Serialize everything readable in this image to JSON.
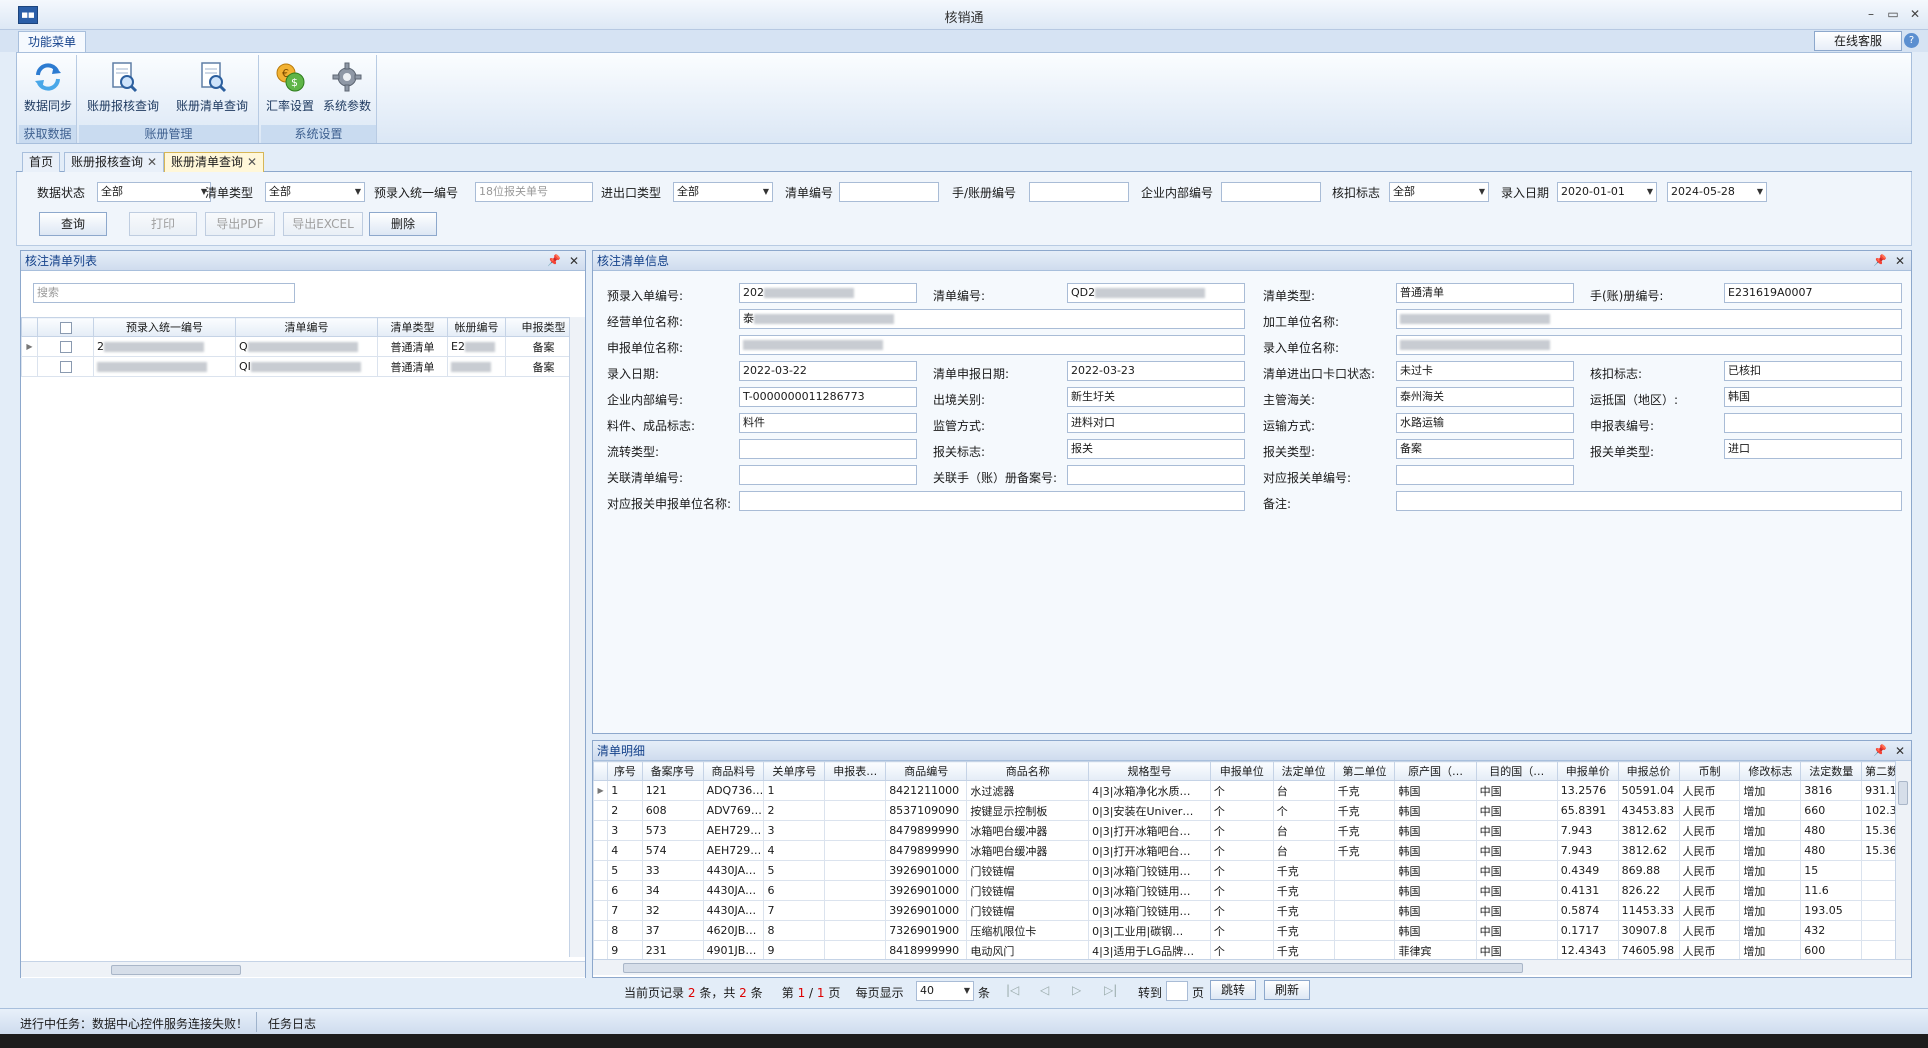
{
  "window": {
    "title": "核销通",
    "minimize": "–",
    "restore": "▭",
    "close": "✕"
  },
  "ribbon": {
    "tab": "功能菜单",
    "online_service": "在线客服",
    "help": "?",
    "groups": [
      {
        "label": "获取数据",
        "buttons": [
          {
            "label": "数据同步",
            "icon": "sync-icon"
          }
        ]
      },
      {
        "label": "账册管理",
        "buttons": [
          {
            "label": "账册报核查询",
            "icon": "document-search-icon"
          },
          {
            "label": "账册清单查询",
            "icon": "document-search-icon"
          }
        ]
      },
      {
        "label": "系统设置",
        "buttons": [
          {
            "label": "汇率设置",
            "icon": "exchange-rate-icon"
          },
          {
            "label": "系统参数",
            "icon": "gear-icon"
          }
        ]
      }
    ]
  },
  "doc_tabs": [
    {
      "label": "首页",
      "closable": false
    },
    {
      "label": "账册报核查询",
      "closable": true
    },
    {
      "label": "账册清单查询",
      "closable": true,
      "active": true
    }
  ],
  "filters": {
    "data_status": {
      "label": "数据状态",
      "value": "全部"
    },
    "list_type": {
      "label": "清单类型",
      "value": "全部"
    },
    "pre_entry_no": {
      "label": "预录入统一编号",
      "placeholder": "18位报关单号"
    },
    "ie_type": {
      "label": "进出口类型",
      "value": "全部"
    },
    "list_no": {
      "label": "清单编号",
      "value": ""
    },
    "manual_no": {
      "label": "手/账册编号",
      "value": ""
    },
    "internal_no": {
      "label": "企业内部编号",
      "value": ""
    },
    "verify_flag": {
      "label": "核扣标志",
      "value": "全部"
    },
    "entry_date": {
      "label": "录入日期",
      "from": "2020-01-01",
      "to": "2024-05-28"
    }
  },
  "actions": {
    "query": "查询",
    "print": "打印",
    "export_pdf": "导出PDF",
    "export_excel": "导出EXCEL",
    "delete": "删除"
  },
  "list_panel": {
    "title": "核注清单列表",
    "search_placeholder": "搜索",
    "columns": [
      "预录入统一编号",
      "清单编号",
      "清单类型",
      "帐册编号",
      "申报类型"
    ],
    "rows": [
      {
        "pre_no": "2",
        "list_no": "Q",
        "type": "普通清单",
        "book": "E2",
        "decl": "备案"
      },
      {
        "pre_no": "",
        "list_no": "QI",
        "type": "普通清单",
        "book": "",
        "decl": "备案"
      }
    ]
  },
  "info_panel": {
    "title": "核注清单信息",
    "fields": {
      "pre_no": {
        "label": "预录入单编号:",
        "value": "202"
      },
      "list_no": {
        "label": "清单编号:",
        "value": "QD2"
      },
      "list_type": {
        "label": "清单类型:",
        "value": "普通清单"
      },
      "book_no": {
        "label": "手(账)册编号:",
        "value": "E231619A0007"
      },
      "biz_unit": {
        "label": "经营单位名称:",
        "value": "泰"
      },
      "proc_unit": {
        "label": "加工单位名称:",
        "value": ""
      },
      "decl_unit": {
        "label": "申报单位名称:",
        "value": ""
      },
      "entry_unit": {
        "label": "录入单位名称:",
        "value": ""
      },
      "entry_date": {
        "label": "录入日期:",
        "value": "2022-03-22"
      },
      "decl_date": {
        "label": "清单申报日期:",
        "value": "2022-03-23"
      },
      "gate_status": {
        "label": "清单进出口卡口状态:",
        "value": "未过卡"
      },
      "verify_flag": {
        "label": "核扣标志:",
        "value": "已核扣"
      },
      "internal_no": {
        "label": "企业内部编号:",
        "value": "T-0000000011286773"
      },
      "port": {
        "label": "出境关别:",
        "value": "新生圩关"
      },
      "customs": {
        "label": "主管海关:",
        "value": "泰州海关"
      },
      "country": {
        "label": "运抵国（地区）:",
        "value": "韩国"
      },
      "material_flag": {
        "label": "料件、成品标志:",
        "value": "料件"
      },
      "supervision": {
        "label": "监管方式:",
        "value": "进料对口"
      },
      "transport": {
        "label": "运输方式:",
        "value": "水路运输"
      },
      "decl_form_no": {
        "label": "申报表编号:",
        "value": ""
      },
      "flow_type": {
        "label": "流转类型:",
        "value": ""
      },
      "customs_flag": {
        "label": "报关标志:",
        "value": "报关"
      },
      "customs_type": {
        "label": "报关类型:",
        "value": "备案"
      },
      "customs_form_type": {
        "label": "报关单类型:",
        "value": "进口"
      },
      "related_list": {
        "label": "关联清单编号:",
        "value": ""
      },
      "related_book": {
        "label": "关联手（账）册备案号:",
        "value": ""
      },
      "related_customs_no": {
        "label": "对应报关单编号:",
        "value": ""
      },
      "related_decl_unit": {
        "label": "对应报关申报单位名称:",
        "value": ""
      },
      "remark": {
        "label": "备注:",
        "value": ""
      }
    }
  },
  "detail_panel": {
    "title": "清单明细",
    "columns": [
      "序号",
      "备案序号",
      "商品料号",
      "关单序号",
      "申报表…",
      "商品编号",
      "商品名称",
      "规格型号",
      "申报单位",
      "法定单位",
      "第二单位",
      "原产国（…",
      "目的国（…",
      "申报单价",
      "申报总价",
      "币制",
      "修改标志",
      "法定数量",
      "第二数量"
    ],
    "rows": [
      [
        "1",
        "121",
        "ADQ736…",
        "1",
        "",
        "8421211000",
        "水过滤器",
        "4|3|冰箱净化水质…",
        "个",
        "台",
        "千克",
        "韩国",
        "中国",
        "13.2576",
        "50591.04",
        "人民币",
        "增加",
        "3816",
        "931.1"
      ],
      [
        "2",
        "608",
        "ADV769…",
        "2",
        "",
        "8537109090",
        "按键显示控制板",
        "0|3|安装在Univer…",
        "个",
        "个",
        "千克",
        "韩国",
        "中国",
        "65.8391",
        "43453.83",
        "人民币",
        "增加",
        "660",
        "102.3"
      ],
      [
        "3",
        "573",
        "AEH729…",
        "3",
        "",
        "8479899990",
        "冰箱吧台缓冲器",
        "0|3|打开冰箱吧台…",
        "个",
        "台",
        "千克",
        "韩国",
        "中国",
        "7.943",
        "3812.62",
        "人民币",
        "增加",
        "480",
        "15.36"
      ],
      [
        "4",
        "574",
        "AEH729…",
        "4",
        "",
        "8479899990",
        "冰箱吧台缓冲器",
        "0|3|打开冰箱吧台…",
        "个",
        "台",
        "千克",
        "韩国",
        "中国",
        "7.943",
        "3812.62",
        "人民币",
        "增加",
        "480",
        "15.36"
      ],
      [
        "5",
        "33",
        "4430JA…",
        "5",
        "",
        "3926901000",
        "门铰链帽",
        "0|3|冰箱门铰链用…",
        "个",
        "千克",
        "",
        "韩国",
        "中国",
        "0.4349",
        "869.88",
        "人民币",
        "增加",
        "15",
        ""
      ],
      [
        "6",
        "34",
        "4430JA…",
        "6",
        "",
        "3926901000",
        "门铰链帽",
        "0|3|冰箱门铰链用…",
        "个",
        "千克",
        "",
        "韩国",
        "中国",
        "0.4131",
        "826.22",
        "人民币",
        "增加",
        "11.6",
        ""
      ],
      [
        "7",
        "32",
        "4430JA…",
        "7",
        "",
        "3926901000",
        "门铰链帽",
        "0|3|冰箱门铰链用…",
        "个",
        "千克",
        "",
        "韩国",
        "中国",
        "0.5874",
        "11453.33",
        "人民币",
        "增加",
        "193.05",
        ""
      ],
      [
        "8",
        "37",
        "4620JB…",
        "8",
        "",
        "7326901900",
        "压缩机限位卡",
        "0|3|工业用|碳钢…",
        "个",
        "千克",
        "",
        "韩国",
        "中国",
        "0.1717",
        "30907.8",
        "人民币",
        "增加",
        "432",
        ""
      ],
      [
        "9",
        "231",
        "4901JB…",
        "9",
        "",
        "8418999990",
        "电动风门",
        "4|3|适用于LG品牌…",
        "个",
        "千克",
        "",
        "菲律宾",
        "中国",
        "12.4343",
        "74605.98",
        "人民币",
        "增加",
        "600",
        ""
      ]
    ]
  },
  "pager": {
    "current_label": "当前页记录",
    "current": "2",
    "unit1": "条，共",
    "total": "2",
    "unit2": "条",
    "page_label": "第",
    "page": "1",
    "sep": "/",
    "pages": "1",
    "page_unit": "页",
    "per_page_label": "每页显示",
    "per_page": "40",
    "per_unit": "条",
    "first": "|◁",
    "prev": "◁",
    "next": "▷",
    "last": "▷|",
    "goto_label": "转到",
    "goto_value": "",
    "goto_unit": "页",
    "jump": "跳转",
    "refresh": "刷新"
  },
  "status": {
    "task": "进行中任务：数据中心控件服务连接失败！",
    "log": "任务日志"
  }
}
